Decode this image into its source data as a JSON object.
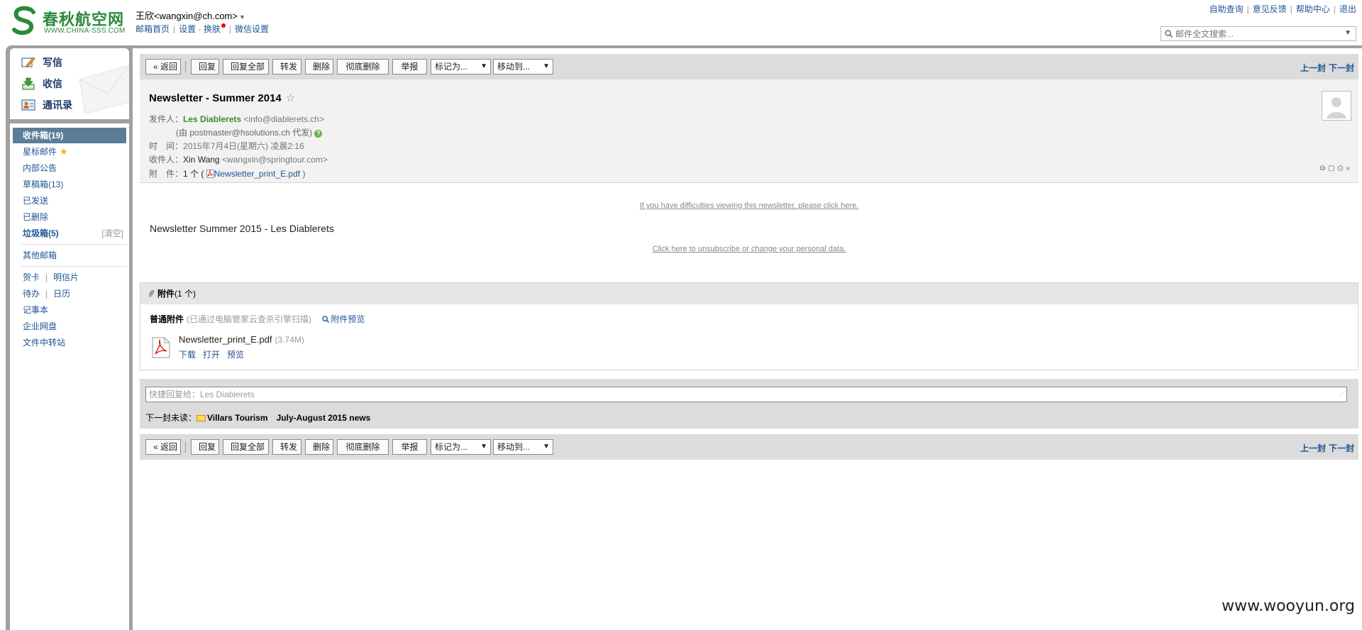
{
  "brand": {
    "name_cn": "春秋航空网",
    "name_en": "WWW.CHINA-SSS.COM",
    "color": "#2a8a3a"
  },
  "header": {
    "user": "王欣<wangxin@ch.com>",
    "links": [
      "邮箱首页",
      "设置",
      "换肤",
      "微信设置"
    ],
    "top_links": [
      "自助查询",
      "意见反馈",
      "帮助中心",
      "退出"
    ],
    "search_placeholder": "邮件全文搜索..."
  },
  "quick_actions": [
    {
      "label": "写信",
      "icon": "compose-icon"
    },
    {
      "label": "收信",
      "icon": "inbox-download-icon"
    },
    {
      "label": "通讯录",
      "icon": "contacts-icon"
    }
  ],
  "folders": {
    "inbox": "收件箱(19)",
    "starred": "星标邮件",
    "internal": "内部公告",
    "drafts": "草稿箱(13)",
    "sent": "已发送",
    "deleted": "已删除",
    "spam": "垃圾箱(5)",
    "spam_clear": "[清空]",
    "other": "其他邮箱",
    "card": "贺卡",
    "postcard": "明信片",
    "todo": "待办",
    "calendar": "日历",
    "notes": "记事本",
    "disk": "企业网盘",
    "transfer": "文件中转站"
  },
  "toolbar": {
    "back": "« 返回",
    "reply": "回复",
    "reply_all": "回复全部",
    "forward": "转发",
    "delete": "删除",
    "delete_forever": "彻底删除",
    "report": "举报",
    "mark_as": "标记为...",
    "move_to": "移动到...",
    "prev": "上一封",
    "next": "下一封"
  },
  "mail": {
    "subject": "Newsletter - Summer 2014",
    "from_label": "发件人：",
    "from_name": "Les Diablerets",
    "from_email": "<info@diablerets.ch>",
    "via": "(由 postmaster@hsolutions.ch 代发)",
    "time_label": "时　间：",
    "time": "2015年7月4日(星期六) 凌晨2:16",
    "to_label": "收件人：",
    "to_name": "Xin Wang",
    "to_email": "<wangxin@springtour.com>",
    "attach_label": "附　件：",
    "attach_count": "1 个 (",
    "attach_name": "Newsletter_print_E.pdf",
    "attach_close": ")"
  },
  "body": {
    "link_view": "If you have difficulties viewing this newsletter, please click here.",
    "title": "Newsletter Summer 2015 - Les Diablerets",
    "link_unsub": "Click here to unsubscribe or change your personal data."
  },
  "attachments": {
    "header": "附件",
    "header_count": "(1 个)",
    "type": "普通附件",
    "note": "(已通过电脑管家云查杀引擎扫描)",
    "preview_all": "附件预览",
    "file_name": "Newsletter_print_E.pdf",
    "file_size": "(3.74M)",
    "actions": [
      "下载",
      "打开",
      "预览"
    ]
  },
  "reply": {
    "placeholder": "快捷回复给：Les Diablerets"
  },
  "next_unread": {
    "label": "下一封未读：",
    "from": "Villars Tourism",
    "subject": "July-August 2015 news"
  },
  "watermark": "www.wooyun.org"
}
